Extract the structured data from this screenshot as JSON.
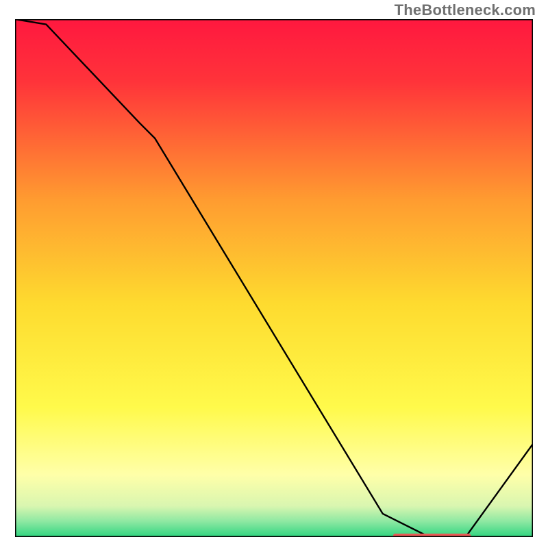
{
  "watermark": "TheBottleneck.com",
  "chart_data": {
    "type": "line",
    "title": "",
    "xlabel": "",
    "ylabel": "",
    "xlim": [
      0,
      100
    ],
    "ylim": [
      0,
      100
    ],
    "series": [
      {
        "name": "curve",
        "x": [
          0,
          6,
          24,
          27,
          71,
          80,
          87,
          100
        ],
        "values": [
          100,
          99,
          80,
          77,
          4.5,
          0,
          0,
          18
        ]
      }
    ],
    "marker_band": {
      "x_start": 73,
      "x_end": 88,
      "y": 0
    },
    "background": {
      "stops": [
        {
          "pct": 0,
          "color": "#ff183f"
        },
        {
          "pct": 12,
          "color": "#ff333a"
        },
        {
          "pct": 35,
          "color": "#ff9c30"
        },
        {
          "pct": 55,
          "color": "#fedb2f"
        },
        {
          "pct": 75,
          "color": "#fffa4b"
        },
        {
          "pct": 88,
          "color": "#ffffa9"
        },
        {
          "pct": 94,
          "color": "#d9f6b0"
        },
        {
          "pct": 97,
          "color": "#8de8a2"
        },
        {
          "pct": 100,
          "color": "#2fd580"
        }
      ]
    },
    "colors": {
      "line": "#000000",
      "marker": "#e85a56",
      "border": "#000000"
    }
  }
}
